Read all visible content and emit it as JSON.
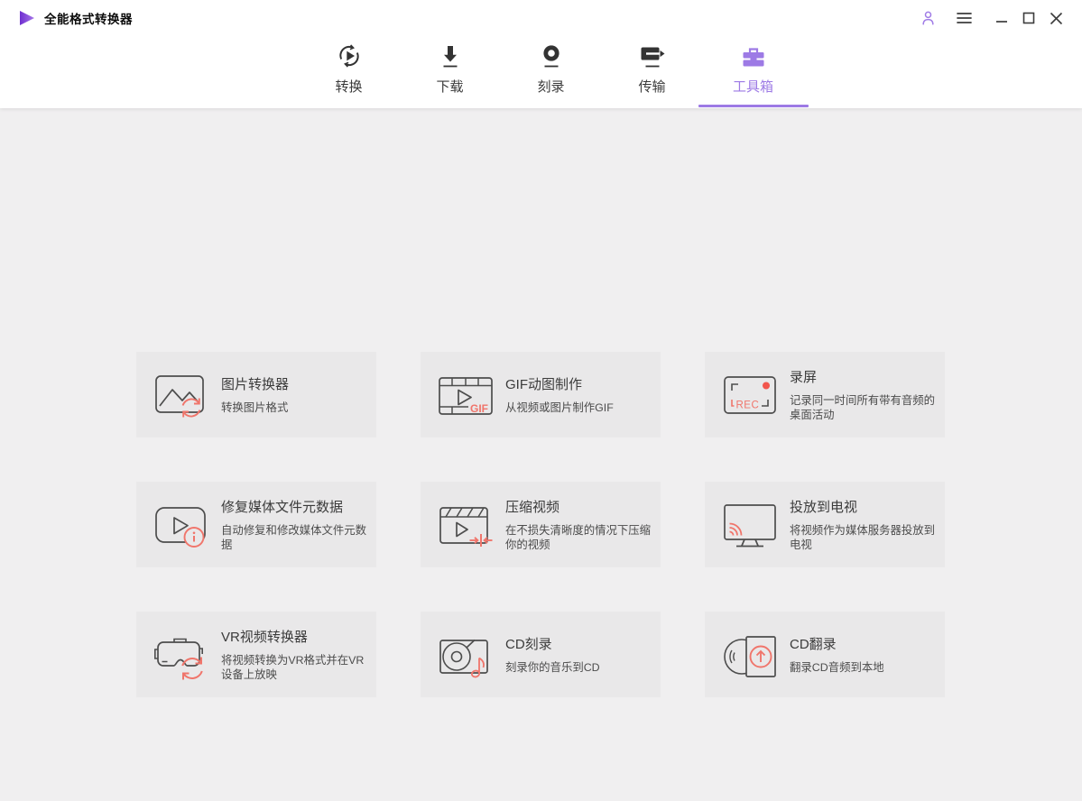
{
  "window": {
    "title": "全能格式转换器",
    "control_icons": [
      "account-icon",
      "menu-icon",
      "minimize-icon",
      "maximize-icon",
      "close-icon"
    ]
  },
  "nav": {
    "tabs": [
      {
        "label": "转换",
        "icon": "convert-icon",
        "active": false
      },
      {
        "label": "下载",
        "icon": "download-icon",
        "active": false
      },
      {
        "label": "刻录",
        "icon": "burn-icon",
        "active": false
      },
      {
        "label": "传输",
        "icon": "transfer-icon",
        "active": false
      },
      {
        "label": "工具箱",
        "icon": "toolbox-icon",
        "active": true
      }
    ]
  },
  "toolbox": {
    "cards": [
      {
        "title": "图片转换器",
        "description": "转换图片格式",
        "icon": "image-converter-icon"
      },
      {
        "title": "GIF动图制作",
        "description": "从视频或图片制作GIF",
        "icon": "gif-maker-icon"
      },
      {
        "title": "录屏",
        "description": "记录同一时间所有带有音频的桌面活动",
        "icon": "screen-record-icon"
      },
      {
        "title": "修复媒体文件元数据",
        "description": "自动修复和修改媒体文件元数据",
        "icon": "fix-metadata-icon"
      },
      {
        "title": "压缩视频",
        "description": "在不损失清晰度的情况下压缩你的视频",
        "icon": "compress-video-icon"
      },
      {
        "title": "投放到电视",
        "description": "将视频作为媒体服务器投放到电视",
        "icon": "cast-to-tv-icon"
      },
      {
        "title": "VR视频转换器",
        "description": "将视频转换为VR格式并在VR设备上放映",
        "icon": "vr-converter-icon"
      },
      {
        "title": "CD刻录",
        "description": "刻录你的音乐到CD",
        "icon": "cd-burn-icon"
      },
      {
        "title": "CD翻录",
        "description": "翻录CD音频到本地",
        "icon": "cd-rip-icon"
      }
    ],
    "icon_labels": {
      "rec": "REC",
      "gif": "GIF"
    }
  },
  "colors": {
    "accent_purple": "#9d7ae5",
    "coral": "#f0756b",
    "red_dot": "#f2564d",
    "background": "#f0eff0",
    "card": "#e9e8e9"
  }
}
